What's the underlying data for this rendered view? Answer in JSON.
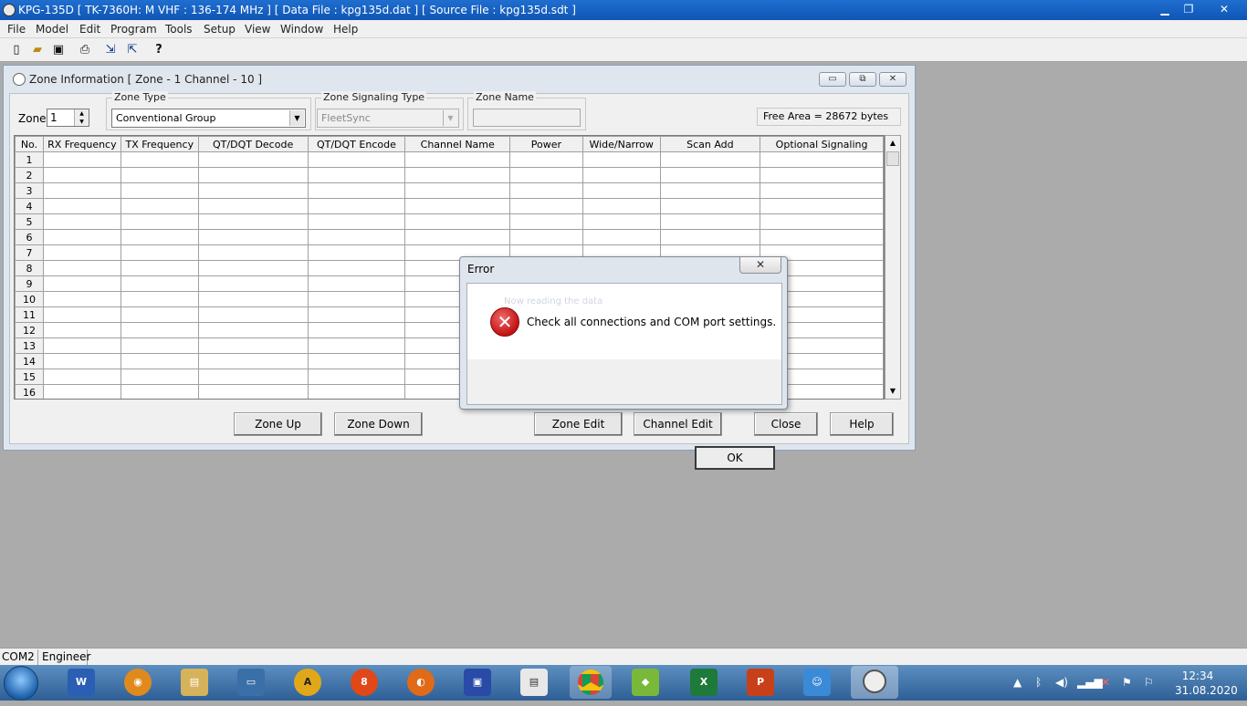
{
  "app": {
    "title": "KPG-135D  [ TK-7360H: M VHF : 136-174 MHz ] [ Data File : kpg135d.dat ] [ Source File : kpg135d.sdt ]"
  },
  "menu": [
    "File",
    "Model",
    "Edit",
    "Program",
    "Tools",
    "Setup",
    "View",
    "Window",
    "Help"
  ],
  "toolbar": {
    "icons": [
      "new-file-icon",
      "open-folder-icon",
      "save-disk-icon",
      "print-icon",
      "read-radio-icon",
      "write-radio-icon",
      "help-icon"
    ]
  },
  "zone_window": {
    "title": "Zone Information [ Zone - 1  Channel - 10 ]",
    "zone_label": "Zone",
    "zone_value": "1",
    "zone_type": {
      "label": "Zone Type",
      "value": "Conventional Group"
    },
    "zone_signaling": {
      "label": "Zone Signaling Type",
      "value": "FleetSync"
    },
    "zone_name": {
      "label": "Zone Name",
      "value": ""
    },
    "free_area": "Free Area = 28672 bytes",
    "columns": [
      "No.",
      "RX Frequency",
      "TX Frequency",
      "QT/DQT Decode",
      "QT/DQT Encode",
      "Channel Name",
      "Power",
      "Wide/Narrow",
      "Scan Add",
      "Optional Signaling"
    ],
    "rows": [
      "1",
      "2",
      "3",
      "4",
      "5",
      "6",
      "7",
      "8",
      "9",
      "10",
      "11",
      "12",
      "13",
      "14",
      "15",
      "16"
    ],
    "buttons": {
      "zone_up": "Zone Up",
      "zone_down": "Zone Down",
      "zone_edit": "Zone Edit",
      "channel_edit": "Channel Edit",
      "close": "Close",
      "help": "Help"
    }
  },
  "error_dialog": {
    "title": "Error",
    "message": "Check all connections and COM port settings.",
    "ok": "OK",
    "background_text": "Now reading the data"
  },
  "status_bar": {
    "port": "COM2",
    "mode": "Engineer"
  },
  "taskbar": {
    "time": "12:34",
    "date": "31.08.2020"
  },
  "colors": {
    "titlebar": "#1f6fd0",
    "taskbar": "#2d5f96",
    "error_icon": "#c21212"
  }
}
